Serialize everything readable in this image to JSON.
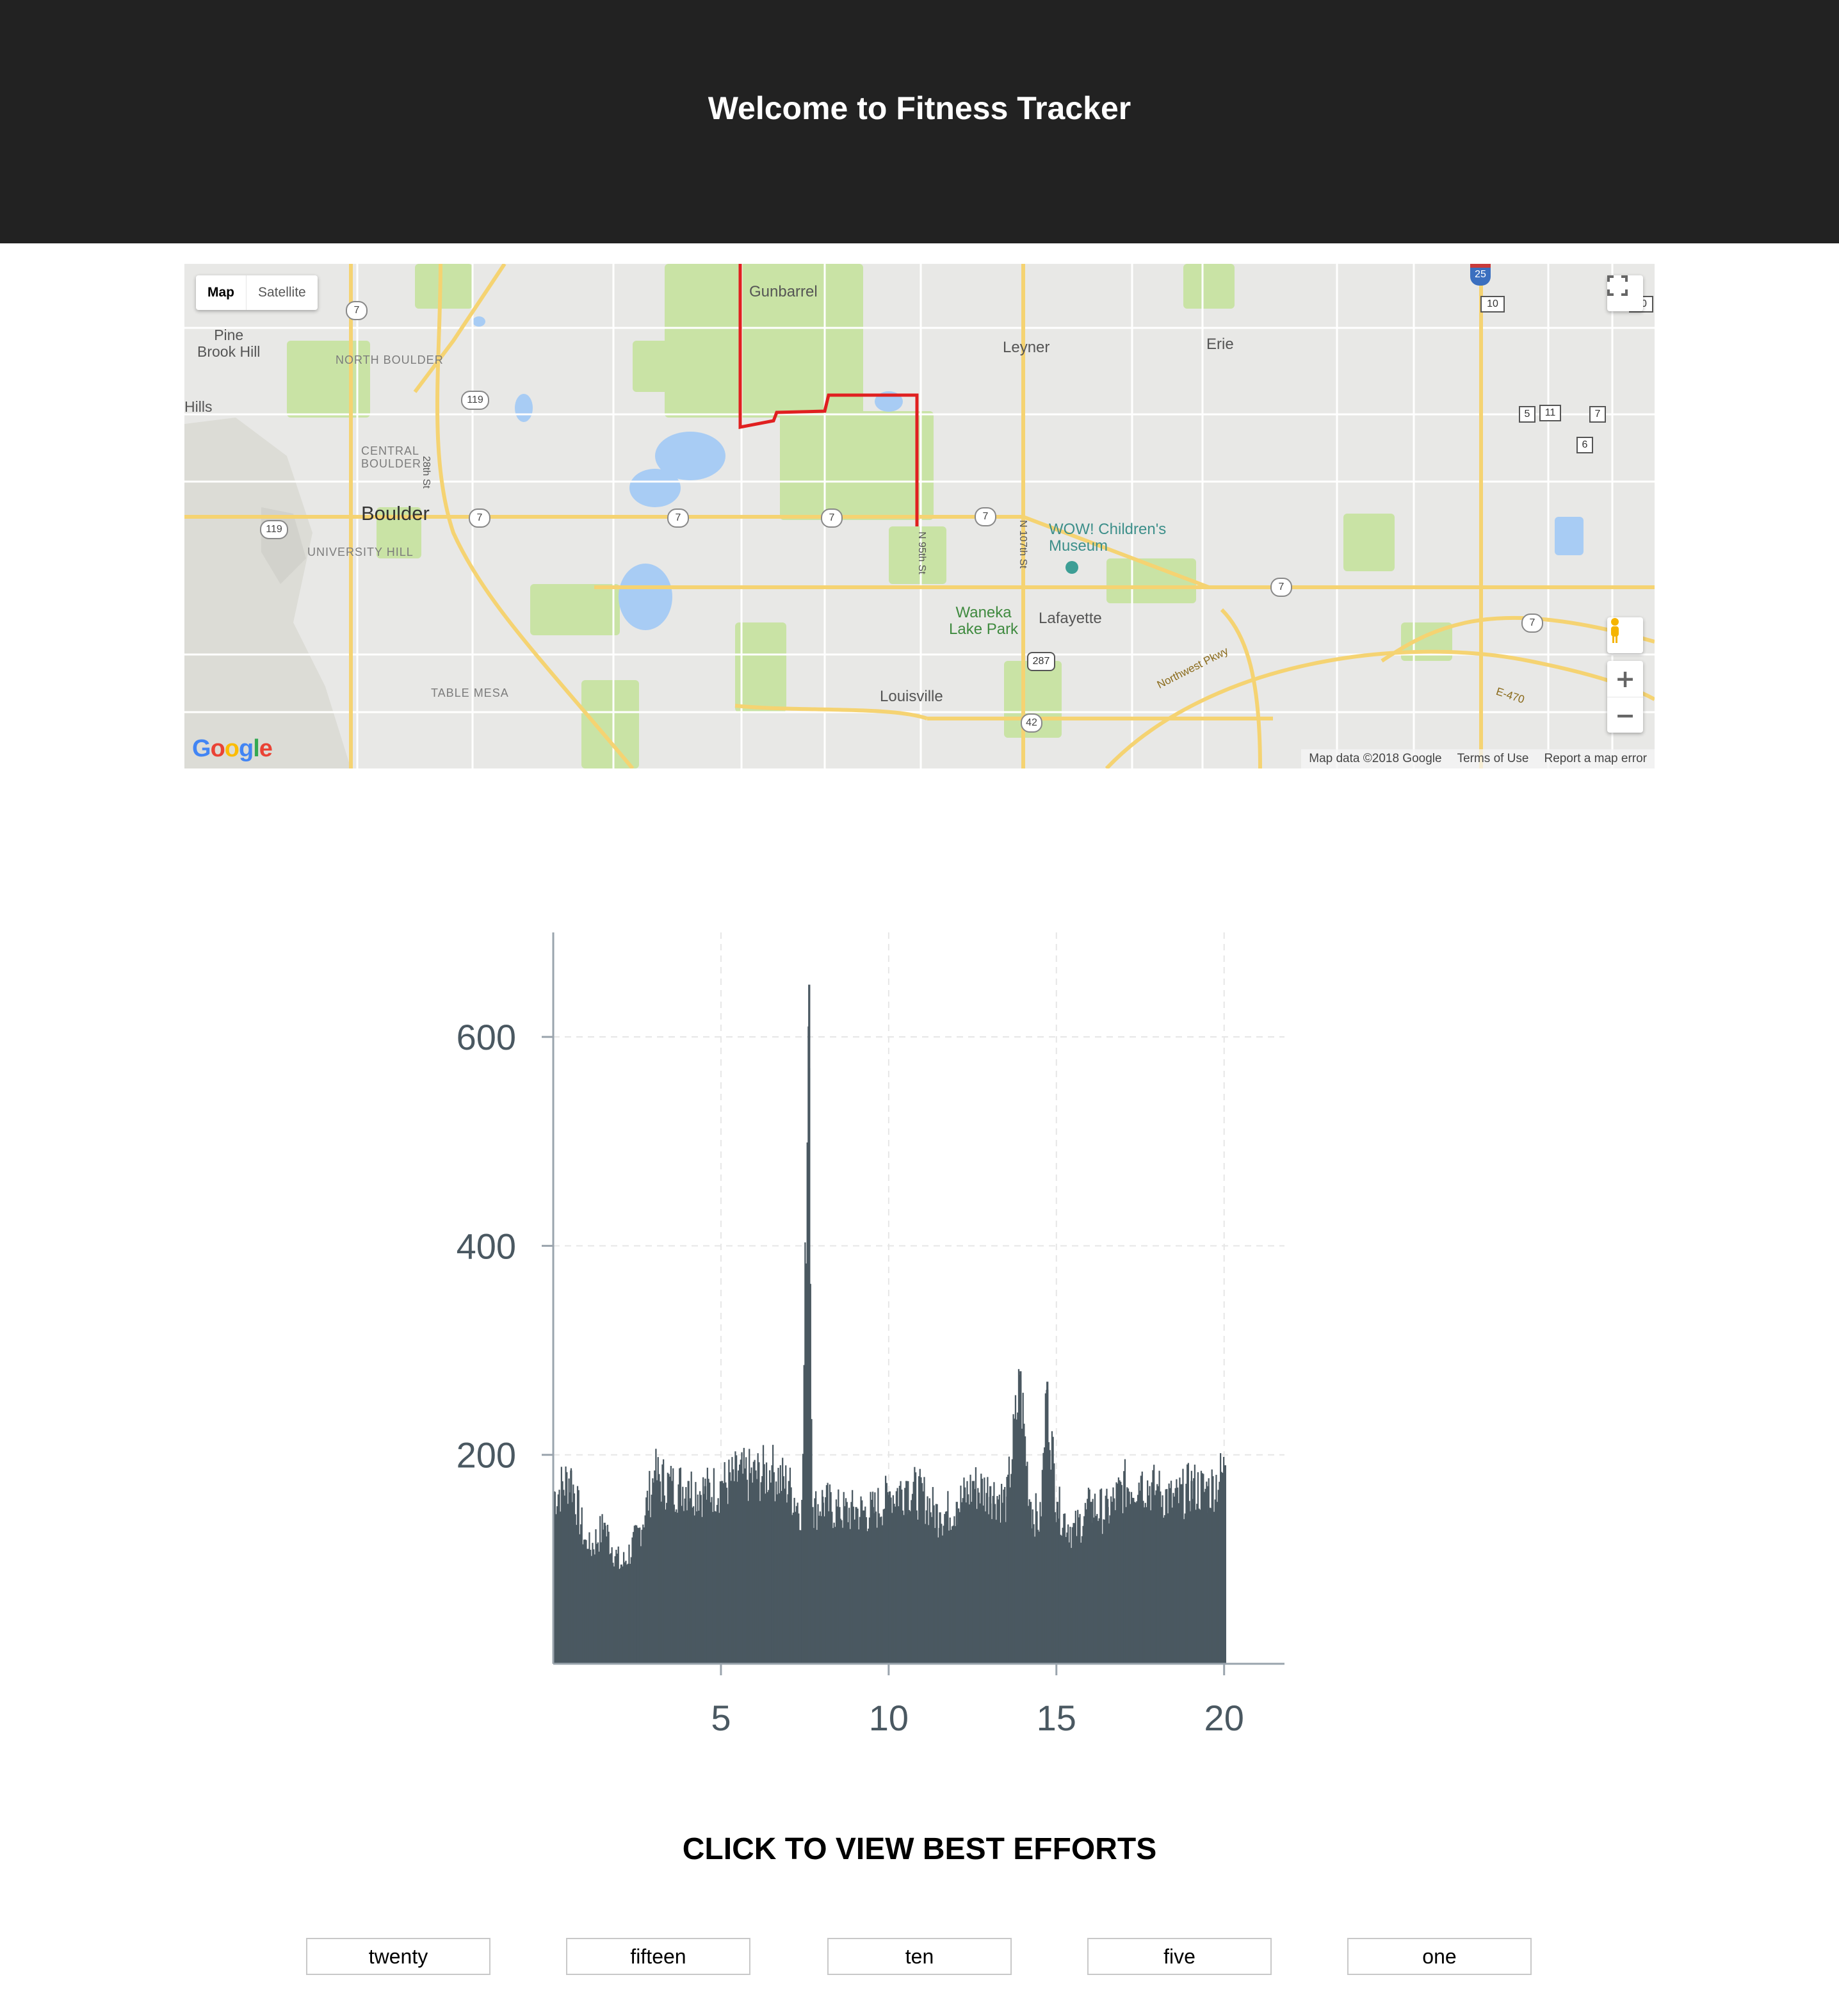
{
  "header": {
    "title": "Welcome to Fitness Tracker",
    "bg_color": "#222222"
  },
  "map": {
    "type_control": {
      "map_label": "Map",
      "satellite_label": "Satellite",
      "active": "Map"
    },
    "places": {
      "pine_brook_1": "Pine",
      "pine_brook_2": "Brook Hill",
      "north_boulder": "NORTH BOULDER",
      "central_1": "CENTRAL",
      "central_2": "BOULDER",
      "boulder": "Boulder",
      "university_hill": "UNIVERSITY HILL",
      "table_mesa": "TABLE MESA",
      "gunbarrel": "Gunbarrel",
      "leyner": "Leyner",
      "erie": "Erie",
      "wow_1": "WOW! Children's",
      "wow_2": "Museum",
      "waneka_1": "Waneka",
      "waneka_2": "Lake Park",
      "lafayette": "Lafayette",
      "louisville": "Louisville",
      "hills": "Hills",
      "street_28th": "28th St",
      "street_95th": "N 95th St",
      "street_107th": "N 107th St",
      "northwest_pkwy": "Northwest Pkwy",
      "e470": "E-470"
    },
    "shields": {
      "s7a": "7",
      "s7b": "7",
      "s7c": "7",
      "s7d": "7",
      "s7e": "7",
      "s7f": "7",
      "s7g": "7",
      "s119a": "119",
      "s119b": "119",
      "s10a": "10",
      "s10b": "10",
      "s5": "5",
      "s7h": "7",
      "s11": "11",
      "s6": "6",
      "s287": "287",
      "s42": "42",
      "s25": "25"
    },
    "logo": "Google",
    "footer": {
      "data": "Map data ©2018 Google",
      "terms": "Terms of Use",
      "report": "Report a map error"
    },
    "route_color": "#e02020",
    "icons": {
      "fullscreen": "fullscreen-icon",
      "pegman": "pegman-icon",
      "zoom_in": "plus-icon",
      "zoom_out": "minus-icon"
    }
  },
  "chart_data": {
    "type": "bar",
    "title": "",
    "xlabel": "",
    "ylabel": "",
    "xlim": [
      0,
      21.8
    ],
    "ylim": [
      0,
      700
    ],
    "x_ticks": [
      5,
      10,
      15,
      20
    ],
    "y_ticks": [
      200,
      400,
      600
    ],
    "grid": true,
    "bar_color": "#4a5861",
    "series": [
      {
        "x": [
          0.0,
          0.5,
          1.0,
          1.5,
          2.0,
          2.5,
          3.0,
          3.5,
          4.0,
          4.5,
          5.0,
          5.5,
          6.0,
          6.5,
          7.0,
          7.4,
          7.6,
          7.7,
          8.0,
          8.5,
          9.0,
          9.5,
          10.0,
          10.5,
          11.0,
          11.5,
          12.0,
          12.5,
          13.0,
          13.5,
          13.9,
          14.2,
          14.5,
          14.7,
          15.0,
          15.5,
          16.0,
          16.5,
          17.0,
          17.5,
          18.0,
          18.5,
          19.0,
          19.5,
          20.0
        ],
        "values": [
          165,
          185,
          110,
          135,
          95,
          125,
          185,
          175,
          175,
          170,
          175,
          185,
          185,
          190,
          175,
          150,
          650,
          150,
          160,
          150,
          150,
          150,
          165,
          175,
          165,
          145,
          155,
          175,
          170,
          160,
          280,
          155,
          140,
          270,
          155,
          130,
          155,
          150,
          175,
          180,
          170,
          160,
          175,
          170,
          190
        ]
      }
    ]
  },
  "efforts": {
    "heading": "CLICK TO VIEW BEST EFFORTS",
    "buttons": [
      "twenty",
      "fifteen",
      "ten",
      "five",
      "one"
    ]
  }
}
